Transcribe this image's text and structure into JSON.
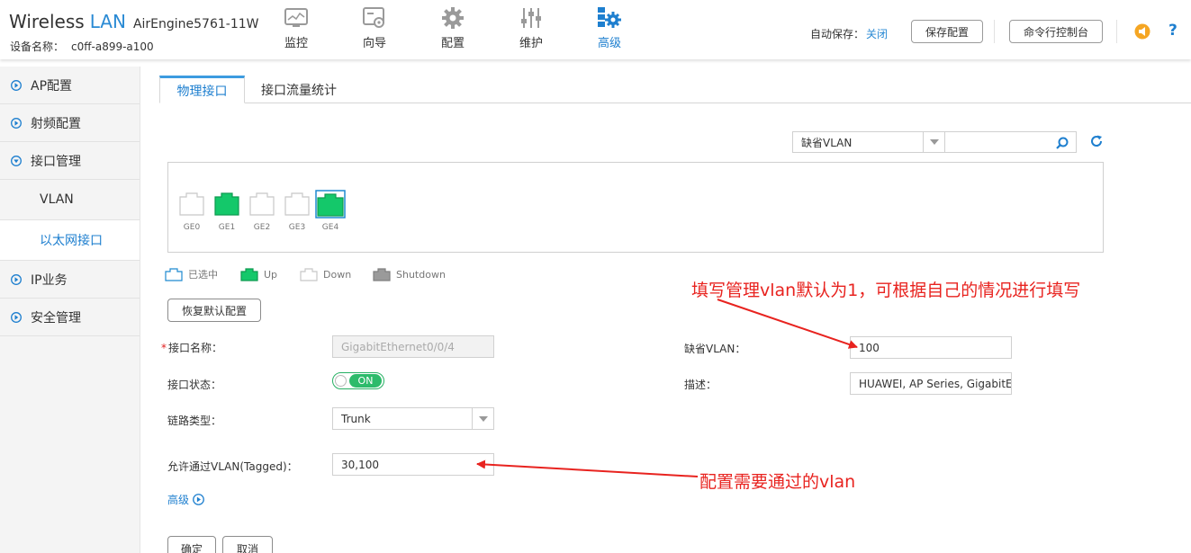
{
  "header": {
    "brand_wireless": "Wireless",
    "brand_lan": "LAN",
    "model": "AirEngine5761-11W",
    "device_label": "设备名称：",
    "device_name": "c0ff-a899-a100",
    "nav": [
      {
        "label": "监控",
        "icon": "monitor-icon"
      },
      {
        "label": "向导",
        "icon": "wizard-icon"
      },
      {
        "label": "配置",
        "icon": "gear-icon"
      },
      {
        "label": "维护",
        "icon": "sliders-icon"
      },
      {
        "label": "高级",
        "icon": "advanced-gear-icon",
        "active": true
      }
    ],
    "autosave_label": "自动保存：",
    "autosave_value": "关闭",
    "save_config_button": "保存配置",
    "cli_console_button": "命令行控制台",
    "colors": {
      "accent": "#1e7fcf",
      "orange": "#f5a623"
    }
  },
  "sidebar": {
    "items": [
      {
        "label": "AP配置",
        "expanded": false
      },
      {
        "label": "射频配置",
        "expanded": false
      },
      {
        "label": "接口管理",
        "expanded": true
      },
      {
        "label": "IP业务",
        "expanded": false
      },
      {
        "label": "安全管理",
        "expanded": false
      }
    ],
    "subitems": [
      {
        "label": "VLAN",
        "active": false
      },
      {
        "label": "以太网接口",
        "active": true
      }
    ]
  },
  "tabs": [
    {
      "label": "物理接口",
      "active": true
    },
    {
      "label": "接口流量统计",
      "active": false
    }
  ],
  "filter": {
    "select_value": "缺省VLAN",
    "search_value": ""
  },
  "ports": [
    {
      "label": "GE0",
      "status": "down"
    },
    {
      "label": "GE1",
      "status": "up"
    },
    {
      "label": "GE2",
      "status": "down"
    },
    {
      "label": "GE3",
      "status": "down"
    },
    {
      "label": "GE4",
      "status": "up-selected"
    }
  ],
  "legend": [
    {
      "label": "已选中",
      "kind": "selected"
    },
    {
      "label": "Up",
      "kind": "up"
    },
    {
      "label": "Down",
      "kind": "down"
    },
    {
      "label": "Shutdown",
      "kind": "shutdown"
    }
  ],
  "restore_button": "恢复默认配置",
  "form": {
    "name_label": "接口名称：",
    "name_required_mark": "*",
    "name_value": "GigabitEthernet0/0/4",
    "status_label": "接口状态：",
    "status_value": "ON",
    "link_type_label": "链路类型：",
    "link_type_value": "Trunk",
    "allowed_vlan_label": "允许通过VLAN(Tagged)：",
    "allowed_vlan_value": "30,100",
    "default_vlan_label": "缺省VLAN：",
    "default_vlan_value": "100",
    "desc_label": "描述：",
    "desc_value": "HUAWEI, AP Series, GigabitE",
    "advanced_label": "高级"
  },
  "ok_button": "确定",
  "cancel_button": "取消",
  "annotations": {
    "default_vlan_note": "填写管理vlan默认为1，可根据自己的情况进行填写",
    "allowed_vlan_note": "配置需要通过的vlan",
    "color": "#e8231f"
  }
}
